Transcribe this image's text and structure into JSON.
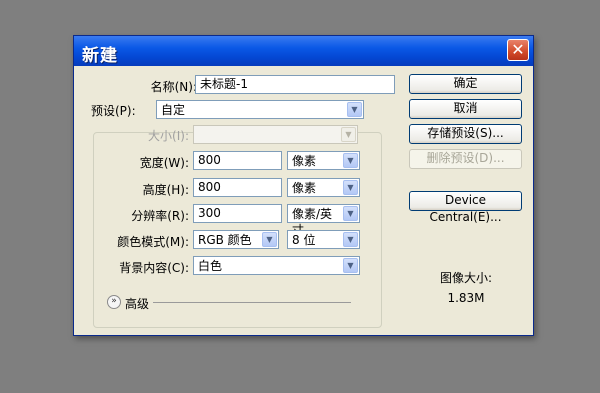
{
  "dialog": {
    "title": "新建",
    "close": "✕"
  },
  "form": {
    "name_label": "名称(N):",
    "name_value": "未标题-1",
    "preset_label": "预设(P):",
    "preset_value": "自定",
    "size_label": "大小(I):",
    "size_value": "",
    "width_label": "宽度(W):",
    "width_value": "800",
    "width_unit": "像素",
    "height_label": "高度(H):",
    "height_value": "800",
    "height_unit": "像素",
    "resolution_label": "分辨率(R):",
    "resolution_value": "300",
    "resolution_unit": "像素/英寸",
    "color_mode_label": "颜色模式(M):",
    "color_mode_value": "RGB 颜色",
    "bit_depth_value": "8 位",
    "background_label": "背景内容(C):",
    "background_value": "白色",
    "advanced_label": "高级"
  },
  "buttons": {
    "ok": "确定",
    "cancel": "取消",
    "save_preset": "存储预设(S)...",
    "delete_preset": "删除预设(D)...",
    "device_central": "Device Central(E)..."
  },
  "info": {
    "image_size_label": "图像大小:",
    "image_size_value": "1.83M"
  },
  "icons": {
    "dropdown": "▼",
    "advanced": "»"
  }
}
